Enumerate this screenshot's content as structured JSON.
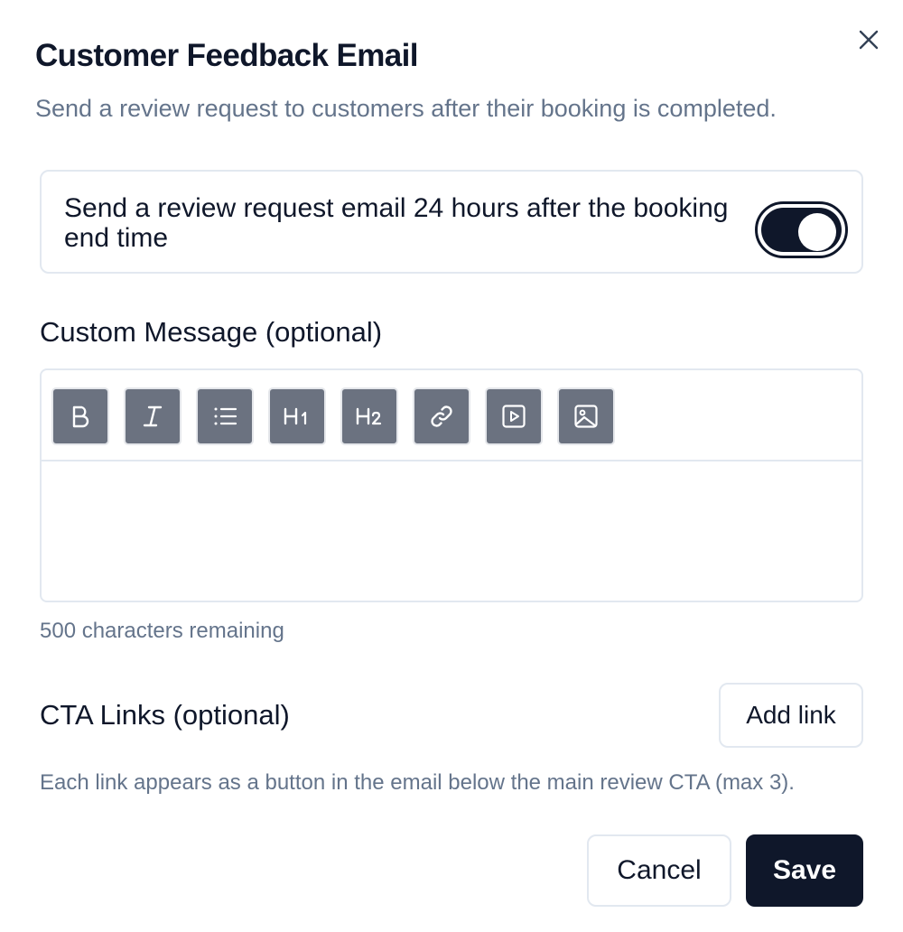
{
  "dialog": {
    "title": "Customer Feedback Email",
    "subtitle": "Send a review request to customers after their booking is completed.",
    "close_icon": "close-icon"
  },
  "toggle": {
    "label": "Send a review request email 24 hours after the booking end time",
    "checked": true
  },
  "message": {
    "label": "Custom Message (optional)",
    "toolbar": [
      {
        "icon": "bold-icon"
      },
      {
        "icon": "italic-icon"
      },
      {
        "icon": "bullet-list-icon"
      },
      {
        "icon": "heading-1-icon",
        "glyph": "H1"
      },
      {
        "icon": "heading-2-icon",
        "glyph": "H2"
      },
      {
        "icon": "link-icon"
      },
      {
        "icon": "video-icon"
      },
      {
        "icon": "image-icon"
      }
    ],
    "value": "",
    "chars_remaining": "500 characters remaining"
  },
  "cta": {
    "label": "CTA Links (optional)",
    "add_label": "Add link",
    "help": "Each link appears as a button in the email below the main review CTA (max 3)."
  },
  "footer": {
    "cancel_label": "Cancel",
    "save_label": "Save"
  },
  "colors": {
    "primary": "#0f172a",
    "muted_text": "#64748b",
    "border": "#e2e8f0",
    "tool_bg": "#6b7280"
  }
}
